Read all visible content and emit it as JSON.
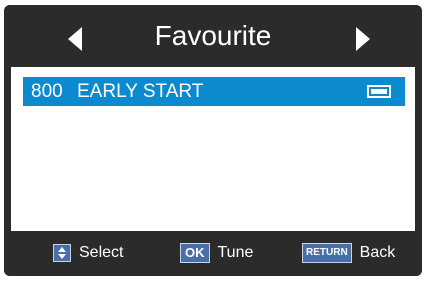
{
  "header": {
    "title": "Favourite",
    "prev_icon": "triangle-left-icon",
    "next_icon": "triangle-right-icon"
  },
  "channels": [
    {
      "number": "800",
      "name": "EARLY START",
      "type_icon": "tv-icon",
      "selected": true
    }
  ],
  "footer": {
    "select_icon": "up-down-icon",
    "select_label": "Select",
    "ok_key": "OK",
    "ok_label": "Tune",
    "return_key": "RETURN",
    "return_label": "Back"
  },
  "colors": {
    "background": "#2b2b2b",
    "highlight": "#0b8ad0",
    "key": "#4a6ea8"
  }
}
